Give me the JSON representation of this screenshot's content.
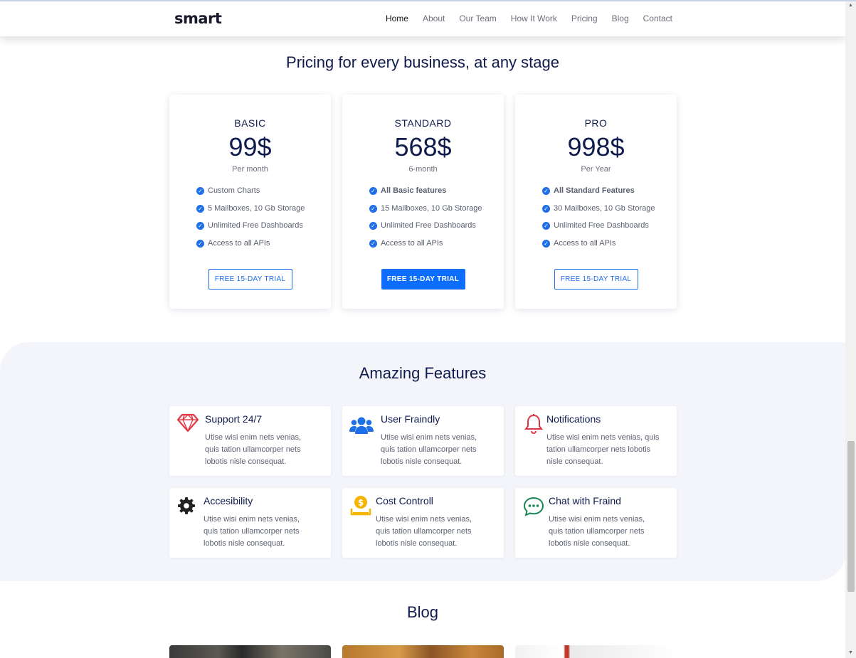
{
  "brand": {
    "logo": "smart"
  },
  "nav": {
    "items": [
      {
        "label": "Home",
        "active": true
      },
      {
        "label": "About"
      },
      {
        "label": "Our Team"
      },
      {
        "label": "How It Work"
      },
      {
        "label": "Pricing"
      },
      {
        "label": "Blog"
      },
      {
        "label": "Contact"
      }
    ]
  },
  "pricing": {
    "title": "Pricing for every business, at any stage",
    "plans": [
      {
        "name": "BASIC",
        "price": "99$",
        "period": "Per month",
        "features": [
          "Custom Charts",
          "5 Mailboxes, 10 Gb Storage",
          "Unlimited Free Dashboards",
          "Access to all APIs"
        ],
        "bold_first": false,
        "button": "FREE 15-DAY TRIAL"
      },
      {
        "name": "STANDARD",
        "price": "568$",
        "period": "6-month",
        "features": [
          "All Basic features",
          "15 Mailboxes, 10 Gb Storage",
          "Unlimited Free Dashboards",
          "Access to all APIs"
        ],
        "bold_first": true,
        "button": "FREE 15-DAY TRIAL"
      },
      {
        "name": "PRO",
        "price": "998$",
        "period": "Per Year",
        "features": [
          "All Standard Features",
          "30 Mailboxes, 10 Gb Storage",
          "Unlimited Free Dashboards",
          "Access to all APIs"
        ],
        "bold_first": true,
        "button": "FREE 15-DAY TRIAL"
      }
    ]
  },
  "features": {
    "title": "Amazing Features",
    "items": [
      {
        "title": "Support 24/7",
        "icon": "diamond-icon",
        "text": [
          "Utise wisi enim nets venias,",
          "quis tation ullamcorper nets",
          "lobotis nisle consequat."
        ]
      },
      {
        "title": "User Fraindly",
        "icon": "users-icon",
        "text": [
          "Utise wisi enim nets venias,",
          "quis tation ullamcorper nets",
          "lobotis nisle consequat."
        ]
      },
      {
        "title": "Notifications",
        "icon": "bell-icon",
        "text": [
          "Utise wisi enim nets venias, quis",
          "tation ullamcorper nets lobotis",
          "nisle consequat."
        ]
      },
      {
        "title": "Accesibility",
        "icon": "gear-icon",
        "text": [
          "Utise wisi enim nets venias,",
          "quis tation ullamcorper nets",
          "lobotis nisle consequat."
        ]
      },
      {
        "title": "Cost Controll",
        "icon": "dollar-coin-icon",
        "text": [
          "Utise wisi enim nets venias,",
          "quis tation ullamcorper nets",
          "lobotis nisle consequat."
        ]
      },
      {
        "title": "Chat with Fraind",
        "icon": "chat-icon",
        "text": [
          "Utise wisi enim nets venias,",
          "quis tation ullamcorper nets",
          "lobotis nisle consequat."
        ]
      }
    ]
  },
  "blog": {
    "title": "Blog"
  },
  "colors": {
    "accent": "#1e6fe8",
    "primary_button": "#0d6efd",
    "heading": "#0f1b4c",
    "features_bg": "#f3f5fa",
    "diamond": "#e63946",
    "bell": "#dc3545",
    "gear": "#222222",
    "coin": "#f4b400",
    "chat": "#198754"
  }
}
